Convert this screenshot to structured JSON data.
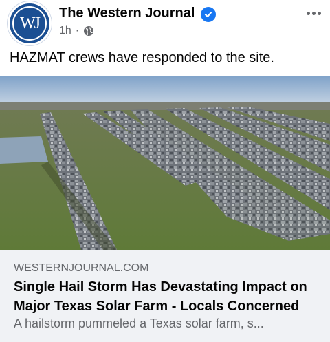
{
  "post": {
    "page_name": "The Western Journal",
    "avatar_initials": "WJ",
    "time": "1h",
    "separator": "·",
    "verified": true,
    "text": "HAZMAT crews have responded to the site."
  },
  "image": {
    "description_icon": "solar-farm-photo"
  },
  "link_preview": {
    "domain": "WESTERNJOURNAL.COM",
    "title": "Single Hail Storm Has Devastating Impact on Major Texas Solar Farm - Locals Concerned",
    "description": "A hailstorm pummeled a Texas solar farm, s..."
  },
  "colors": {
    "brand_blue": "#1b4f93",
    "verified_blue": "#1877f2",
    "secondary_text": "#65676b",
    "preview_bg": "#f0f2f5"
  }
}
